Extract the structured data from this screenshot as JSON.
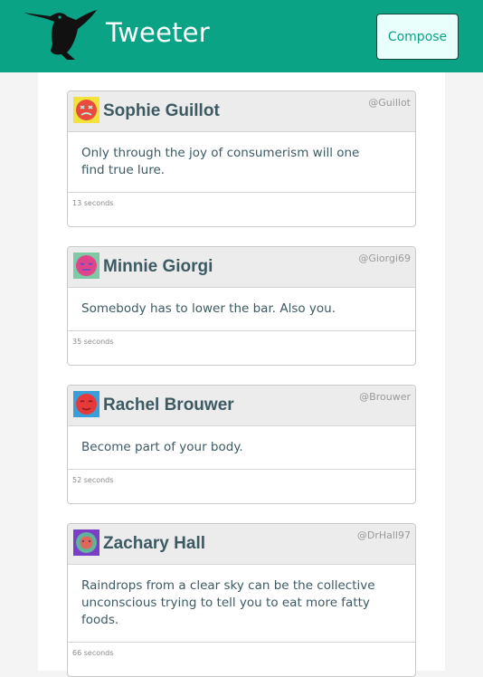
{
  "header": {
    "brand": "Tweeter",
    "compose_label": "Compose",
    "logo_icon": "hummingbird-icon",
    "background_color": "#0aa385"
  },
  "tweets": [
    {
      "name": "Sophie Guillot",
      "handle": "@Guillot",
      "text": "Only through the joy of consumerism will one find true lure.",
      "time": "13 seconds",
      "avatar_icon": "dizzy-face-icon"
    },
    {
      "name": "Minnie Giorgi",
      "handle": "@Giorgi69",
      "text": "Somebody has to lower the bar. Also you.",
      "time": "35 seconds",
      "avatar_icon": "sleepy-face-icon"
    },
    {
      "name": "Rachel Brouwer",
      "handle": "@Brouwer",
      "text": "Become part of your body.",
      "time": "52 seconds",
      "avatar_icon": "sleeping-face-icon"
    },
    {
      "name": "Zachary Hall",
      "handle": "@DrHall97",
      "text": "Raindrops from a clear sky can be the collective unconscious trying to tell you to eat more fatty foods.",
      "time": "66 seconds",
      "avatar_icon": "neutral-face-icon"
    }
  ]
}
